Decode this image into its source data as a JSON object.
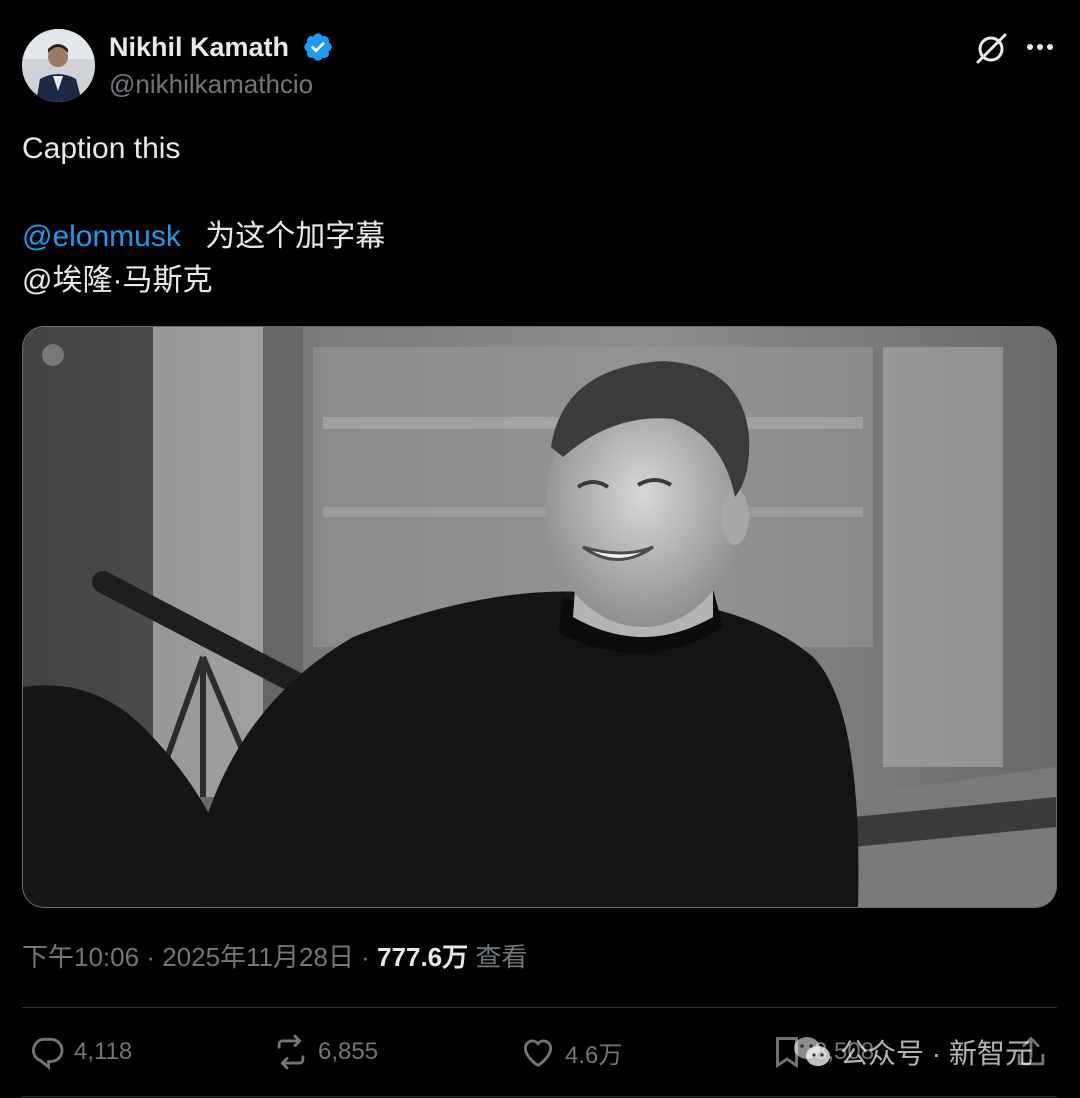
{
  "author": {
    "display_name": "Nikhil Kamath",
    "handle": "@nikhilkamathcio"
  },
  "post": {
    "line1": "Caption this",
    "mention": "@elonmusk",
    "translation": "为这个加字幕",
    "translated_mention": "@埃隆·马斯克"
  },
  "meta": {
    "time": "下午10:06",
    "separator1": " · ",
    "date": "2025年11月28日",
    "separator2": " · ",
    "views": "777.6万",
    "views_label": " 查看"
  },
  "actions": {
    "replies": "4,118",
    "reposts": "6,855",
    "likes": "4.6万",
    "bookmarks": "3,508"
  },
  "watermark": {
    "label": "公众号 · 新智元"
  },
  "colors": {
    "background": "#000000",
    "text": "#e7e9ea",
    "secondary": "#71767b",
    "link": "#1d9bf0",
    "verified": "#1d9bf0",
    "divider": "#2f3336"
  },
  "icons": [
    "verified-badge-icon",
    "grok-icon",
    "more-icon",
    "reply-icon",
    "repost-icon",
    "like-icon",
    "bookmark-icon",
    "share-icon",
    "wechat-icon"
  ]
}
